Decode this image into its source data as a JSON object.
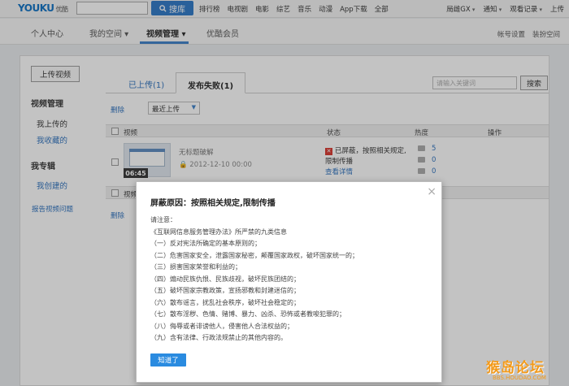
{
  "topbar": {
    "logo": "YOUKU",
    "logo_cn": "优酷",
    "search_button": "搜库",
    "nav": [
      "排行榜",
      "电视剧",
      "电影",
      "综艺",
      "音乐",
      "动漫",
      "App下载",
      "全部"
    ],
    "right": [
      "局雌GX",
      "通知",
      "观看记录",
      "上传"
    ]
  },
  "subnav": {
    "items": [
      "个人中心",
      "我的空间",
      "视频管理",
      "优酷会员"
    ],
    "right": [
      "帐号设置",
      "装扮空间"
    ]
  },
  "sidebar": {
    "upload_button": "上传视频",
    "section1": "视频管理",
    "section1_items": [
      "我上传的",
      "我收藏的"
    ],
    "section2": "我专辑",
    "section2_items": [
      "我创建的"
    ],
    "report": "报告视频问题"
  },
  "content": {
    "tabs": [
      "已上传(1)",
      "发布失败(1)"
    ],
    "keyword_placeholder": "请输入关键词",
    "search_button": "搜索",
    "delete_label": "删除",
    "sort_value": "最近上传",
    "columns": [
      "视频",
      "状态",
      "热度",
      "操作"
    ],
    "video": {
      "duration": "06:45",
      "title": "无标题破解",
      "date": "2012-12-10 00:00",
      "status_text": "已屏蔽，按照相关规定,限制传播",
      "status_link": "查看详情",
      "heat": [
        "5",
        "0",
        "0"
      ]
    },
    "row2_label": "视频"
  },
  "modal": {
    "title": "屏蔽原因：按照相关规定,限制传播",
    "close": "×",
    "lines": [
      "请注意：",
      "《互联网信息服务管理办法》所严禁的九类信息",
      "（一）反对宪法所确定的基本原则的；",
      "（二）危害国家安全，泄露国家秘密，颠覆国家政权，破坏国家统一的；",
      "（三）损害国家荣誉和利益的；",
      "（四）煽动民族仇恨、民族歧视，破坏民族团结的；",
      "（五）破坏国家宗教政策，宣扬邪教和封建迷信的；",
      "（六）散布谣言，扰乱社会秩序，破坏社会稳定的；",
      "（七）散布淫秽、色情、赌博、暴力、凶杀、恐怖或者教唆犯罪的；",
      "（八）侮辱或者诽谤他人，侵害他人合法权益的；",
      "（九）含有法律、行政法规禁止的其他内容的。"
    ],
    "ok_button": "知道了"
  },
  "watermark": {
    "text": "猴岛论坛",
    "url": "BBS.HOUDAO.COM"
  }
}
